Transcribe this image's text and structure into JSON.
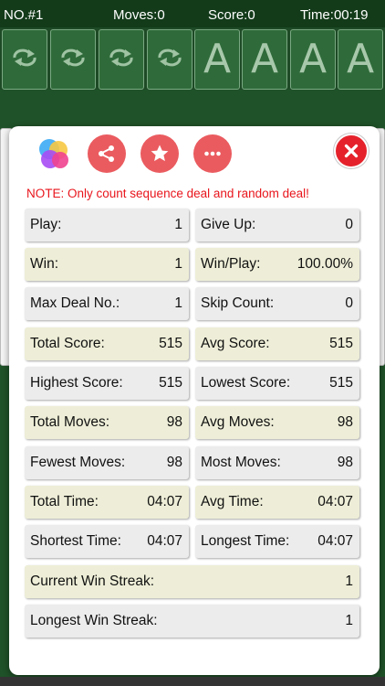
{
  "topbar": {
    "deal_no": "NO.#1",
    "moves": "Moves:0",
    "score": "Score:0",
    "time": "Time:00:19"
  },
  "foundations": [
    "A",
    "A",
    "A",
    "A"
  ],
  "dialog": {
    "note": "NOTE: Only count sequence deal and random deal!",
    "stats": [
      {
        "label": "Play:",
        "value": "1"
      },
      {
        "label": "Give Up:",
        "value": "0"
      },
      {
        "label": "Win:",
        "value": "1"
      },
      {
        "label": "Win/Play:",
        "value": "100.00%"
      },
      {
        "label": "Max Deal No.:",
        "value": "1"
      },
      {
        "label": "Skip Count:",
        "value": "0"
      },
      {
        "label": "Total Score:",
        "value": "515"
      },
      {
        "label": "Avg Score:",
        "value": "515"
      },
      {
        "label": "Highest Score:",
        "value": "515"
      },
      {
        "label": "Lowest Score:",
        "value": "515"
      },
      {
        "label": "Total Moves:",
        "value": "98"
      },
      {
        "label": "Avg Moves:",
        "value": "98"
      },
      {
        "label": "Fewest Moves:",
        "value": "98"
      },
      {
        "label": "Most Moves:",
        "value": "98"
      },
      {
        "label": "Total Time:",
        "value": "04:07"
      },
      {
        "label": "Avg Time:",
        "value": "04:07"
      },
      {
        "label": "Shortest Time:",
        "value": "04:07"
      },
      {
        "label": "Longest Time:",
        "value": "04:07"
      },
      {
        "label": "Current Win Streak:",
        "value": "1"
      },
      {
        "label": "Longest Win Streak:",
        "value": "1"
      }
    ]
  },
  "icons": {
    "game_center": "game-center-icon",
    "share": "share-icon",
    "star": "star-icon",
    "more": "more-icon",
    "close": "close-icon",
    "recycle": "recycle-icon"
  },
  "colors": {
    "accent_red": "#ea5b5f",
    "close_red": "#e5222b",
    "note_red": "#e8151c",
    "felt_green": "#1f5228",
    "row_gray": "#ececec",
    "row_cream": "#eeeed8"
  }
}
